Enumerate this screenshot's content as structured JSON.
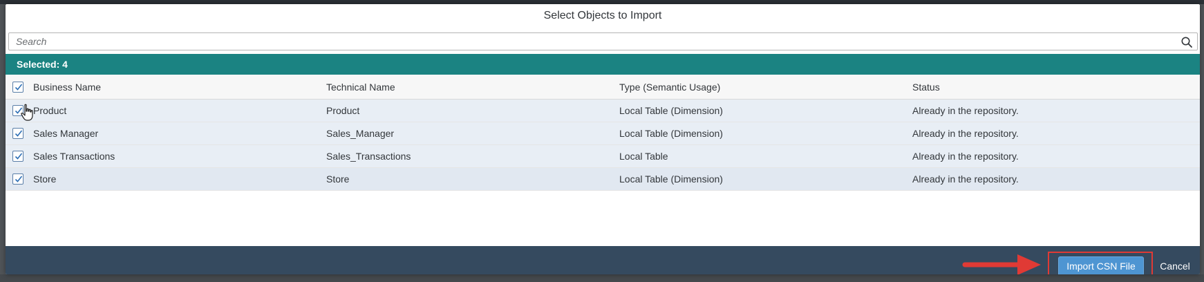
{
  "dialog": {
    "title": "Select Objects to Import"
  },
  "search": {
    "placeholder": "Search"
  },
  "selection": {
    "label": "Selected: 4"
  },
  "table": {
    "columns": [
      "Business Name",
      "Technical Name",
      "Type (Semantic Usage)",
      "Status"
    ],
    "rows": [
      {
        "business_name": "Product",
        "technical_name": "Product",
        "type": "Local Table (Dimension)",
        "status": "Already in the repository.",
        "checked": true
      },
      {
        "business_name": "Sales Manager",
        "technical_name": "Sales_Manager",
        "type": "Local Table (Dimension)",
        "status": "Already in the repository.",
        "checked": true
      },
      {
        "business_name": "Sales Transactions",
        "technical_name": "Sales_Transactions",
        "type": "Local Table",
        "status": "Already in the repository.",
        "checked": true
      },
      {
        "business_name": "Store",
        "technical_name": "Store",
        "type": "Local Table (Dimension)",
        "status": "Already in the repository.",
        "checked": true
      }
    ]
  },
  "footer": {
    "import_label": "Import CSN File",
    "cancel_label": "Cancel"
  },
  "icons": {
    "search": "search-icon",
    "checkbox": "checkmark-icon",
    "cursor": "hand-cursor-icon",
    "annotation": "red-arrow-icon"
  },
  "colors": {
    "header_bar": "#1b8382",
    "footer": "#354a5f",
    "primary_button": "#4e95d2",
    "annotation": "#e03a35"
  }
}
